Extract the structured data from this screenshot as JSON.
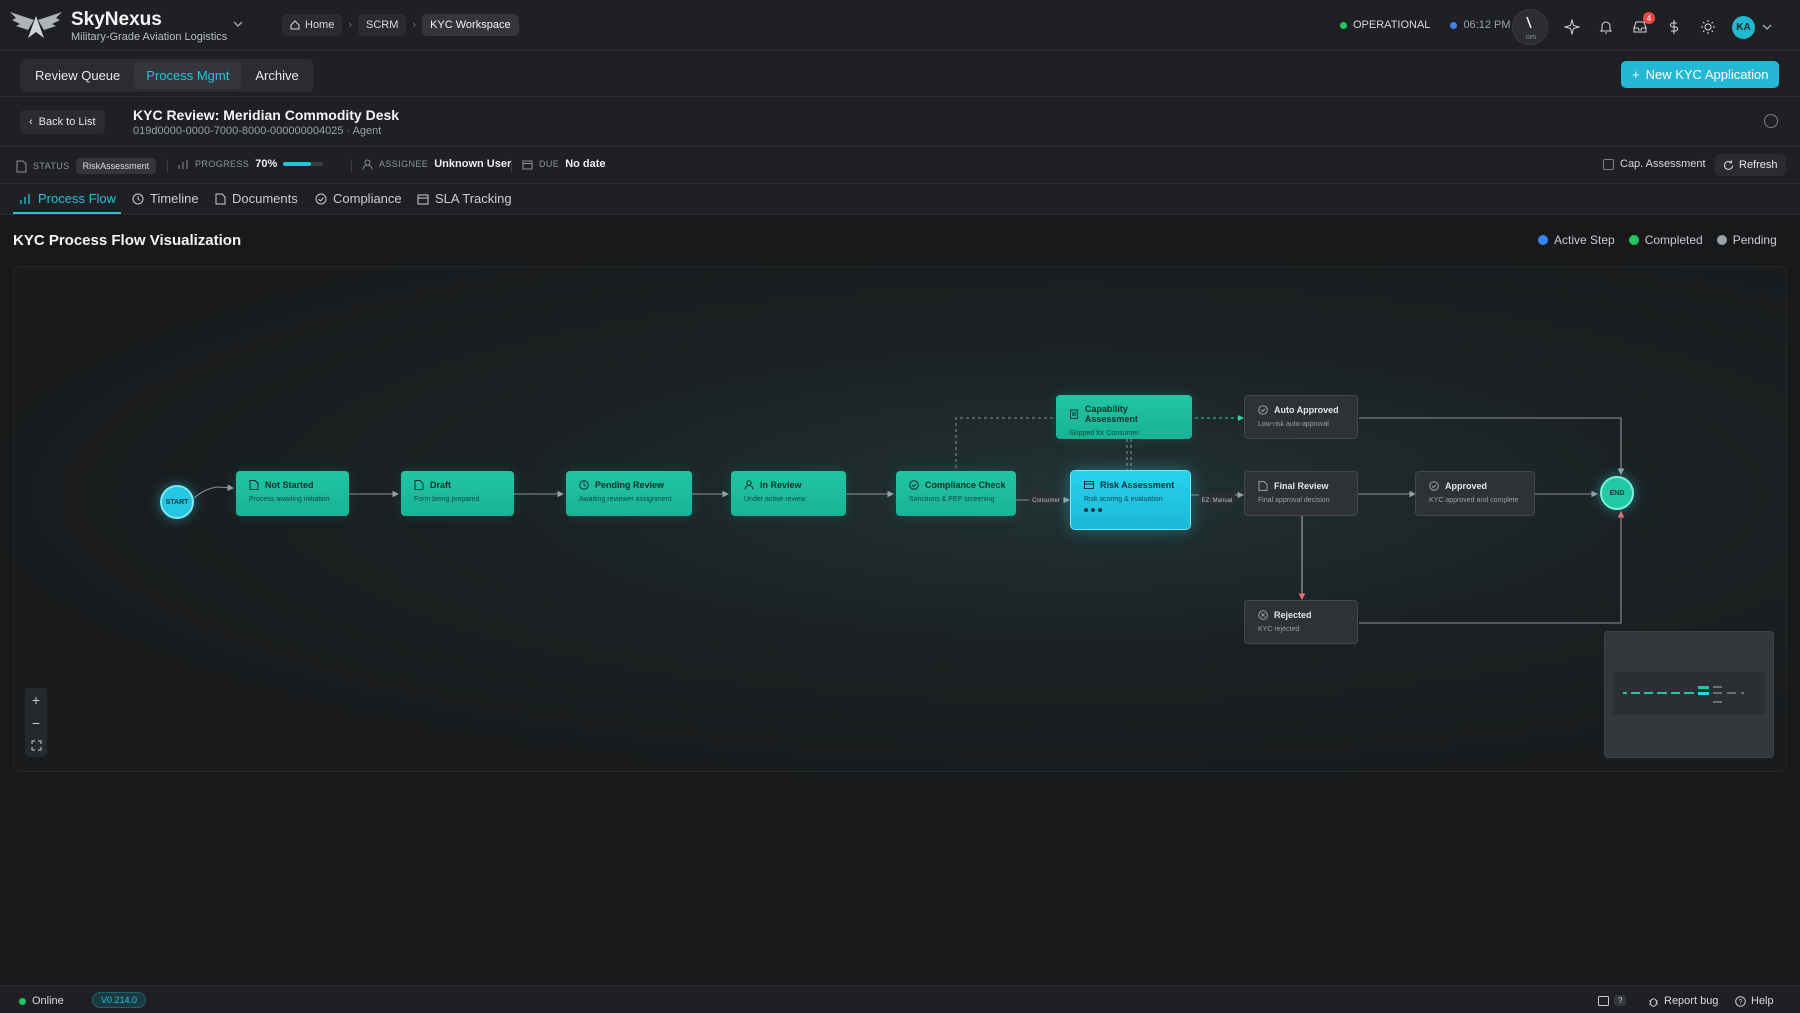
{
  "app": {
    "name": "SkyNexus",
    "tagline": "Military-Grade Aviation Logistics"
  },
  "breadcrumbs": [
    "Home",
    "SCRM",
    "KYC Workspace"
  ],
  "system": {
    "status": "OPERATIONAL",
    "time": "06:12 PM",
    "status_color": "#22c55e",
    "time_color": "#3b82f6"
  },
  "header_icons": {
    "notifications_badge": "4",
    "avatar_initials": "KA",
    "gauge_label": "OPS"
  },
  "module_tabs": [
    {
      "label": "Review Queue",
      "active": false
    },
    {
      "label": "Process Mgmt",
      "active": true
    },
    {
      "label": "Archive",
      "active": false
    }
  ],
  "new_button": "New KYC Application",
  "record": {
    "back": "Back to List",
    "title": "KYC Review: Meridian Commodity Desk",
    "subtitle": "019d0000-0000-7000-8000-000000004025 · Agent"
  },
  "status_row": {
    "status_label": "STATUS",
    "status_value": "RiskAssessment",
    "progress_label": "PROGRESS",
    "progress_value": "70%",
    "progress_fraction": 0.7,
    "assignee_label": "ASSIGNEE",
    "assignee_value": "Unknown User",
    "due_label": "DUE",
    "due_value": "No date",
    "cap_assessment": "Cap. Assessment",
    "refresh": "Refresh"
  },
  "view_tabs": [
    {
      "label": "Process Flow",
      "icon": "bar-chart-icon",
      "active": true
    },
    {
      "label": "Timeline",
      "icon": "clock-icon"
    },
    {
      "label": "Documents",
      "icon": "file-icon"
    },
    {
      "label": "Compliance",
      "icon": "check-circle-icon"
    },
    {
      "label": "SLA Tracking",
      "icon": "calendar-icon"
    }
  ],
  "section_title": "KYC Process Flow Visualization",
  "legend": [
    {
      "label": "Active Step",
      "color": "#3b82f6"
    },
    {
      "label": "Completed",
      "color": "#22c55e"
    },
    {
      "label": "Pending",
      "color": "#9ca3af"
    }
  ],
  "flow": {
    "start": "START",
    "end": "END",
    "edge_labels": {
      "consumer": "Consumer",
      "manual": "EZ: Manual"
    },
    "nodes": [
      {
        "id": "not-started",
        "title": "Not Started",
        "sub": "Process awaiting initiation",
        "state": "completed",
        "icon": "file-icon"
      },
      {
        "id": "draft",
        "title": "Draft",
        "sub": "Form being prepared",
        "state": "completed",
        "icon": "file-icon"
      },
      {
        "id": "pending-review",
        "title": "Pending Review",
        "sub": "Awaiting reviewer assignment",
        "state": "completed",
        "icon": "clock-icon"
      },
      {
        "id": "in-review",
        "title": "In Review",
        "sub": "Under active review",
        "state": "completed",
        "icon": "user-icon"
      },
      {
        "id": "compliance-check",
        "title": "Compliance Check",
        "sub": "Sanctions & PEP screening",
        "state": "completed",
        "icon": "shield-icon"
      },
      {
        "id": "capability-assessment",
        "title": "Capability Assessment",
        "sub": "Skipped for Consumer",
        "state": "completed",
        "icon": "clipboard-icon"
      },
      {
        "id": "risk-assessment",
        "title": "Risk Assessment",
        "sub": "Risk scoring & evaluation",
        "state": "active",
        "icon": "card-icon"
      },
      {
        "id": "auto-approved",
        "title": "Auto Approved",
        "sub": "Low-risk auto-approval",
        "state": "pending",
        "icon": "check-circle-icon"
      },
      {
        "id": "final-review",
        "title": "Final Review",
        "sub": "Final approval decision",
        "state": "pending",
        "icon": "file-icon"
      },
      {
        "id": "approved",
        "title": "Approved",
        "sub": "KYC approved and complete",
        "state": "pending",
        "icon": "check-circle-icon"
      },
      {
        "id": "rejected",
        "title": "Rejected",
        "sub": "KYC rejected",
        "state": "pending",
        "icon": "x-circle-icon"
      }
    ]
  },
  "footer": {
    "status": "Online",
    "version": "V0.214.0",
    "shortcut": "?",
    "report_bug": "Report bug",
    "help": "Help"
  }
}
